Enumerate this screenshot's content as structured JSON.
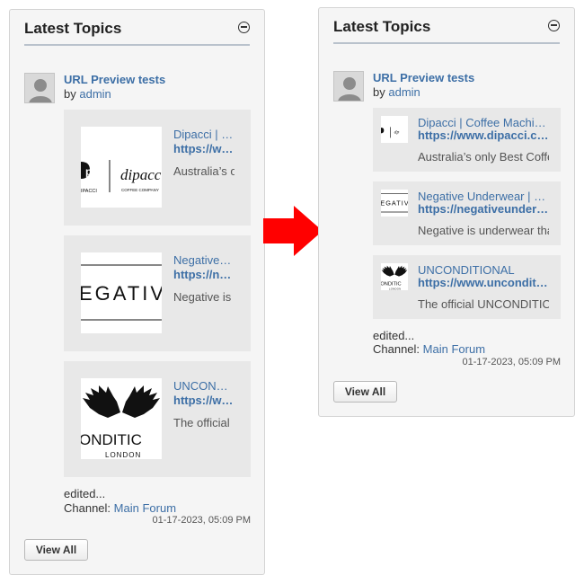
{
  "widget": {
    "title": "Latest Topics",
    "collapse_icon": "minus-circle-icon",
    "topic": {
      "title": "URL Preview tests",
      "by": "by",
      "author": "admin",
      "avatar_icon": "default-user-avatar-icon"
    },
    "previews": [
      {
        "brand": "Dipacci",
        "title_full": "Dipacci | Coffee Machin…",
        "title_cut": "Dipacci | …",
        "url_full": "https://www.dipacci.co…",
        "url_cut": "https://w…",
        "desc": "Australia’s only Best Coffee",
        "desc_cut": "Australia’s o",
        "logo": {
          "mark": "dp",
          "word": "dipacci",
          "sub": "COFFEE COMPANY",
          "left": "IPACCI"
        }
      },
      {
        "brand": "Negative Underwear",
        "title_full": "Negative Underwear | C…",
        "title_cut": "Negative…",
        "url_full": "https://negativeunder…",
        "url_cut": "https://n…",
        "desc": "Negative is underwear that",
        "desc_cut": "Negative is",
        "logo": {
          "word": "EGATIV"
        }
      },
      {
        "brand": "Unconditional",
        "title_full": "UNCONDITIONAL",
        "title_cut": "UNCON…",
        "url_full": "https://www.unconditi…",
        "url_cut": "https://w…",
        "desc": "The official UNCONDITION",
        "desc_cut": "The official",
        "logo": {
          "word": "ONDITIC",
          "sub": "LONDON",
          "icon": "wings-icon"
        }
      }
    ],
    "edited": "edited...",
    "channel_label": "Channel:",
    "channel": "Main Forum",
    "date": "01-17-2023, 05:09 PM",
    "view_all": "View All"
  },
  "arrow_color": "#ff0000",
  "link_color": "#3d6fa6"
}
